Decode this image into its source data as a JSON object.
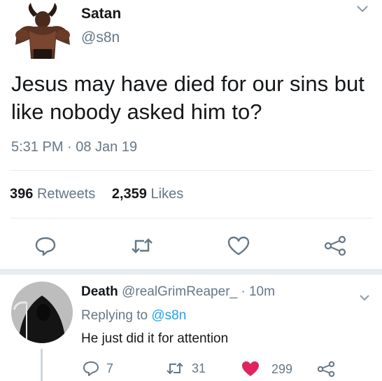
{
  "tweet": {
    "author_name": "Satan",
    "author_handle": "@s8n",
    "text": "Jesus may have died for our sins but like nobody asked him to?",
    "timestamp": "5:31 PM · 08 Jan 19",
    "retweets_count": "396",
    "retweets_label": "Retweets",
    "likes_count": "2,359",
    "likes_label": "Likes",
    "icons": [
      "reply-icon",
      "retweet-icon",
      "like-icon",
      "share-icon",
      "chevron-down-icon"
    ]
  },
  "reply": {
    "author_name": "Death",
    "author_handle": "@realGrimReaper_",
    "separator": "·",
    "time": "10m",
    "replying_prefix": "Replying to",
    "replying_to": "@s8n",
    "text": "He just did it for attention",
    "reply_count": "7",
    "retweet_count": "31",
    "like_count": "299",
    "like_color": "#e0245e"
  },
  "colors": {
    "text": "#14171a",
    "muted": "#657786",
    "link": "#1da1f2",
    "divider": "#e6ecf0"
  }
}
